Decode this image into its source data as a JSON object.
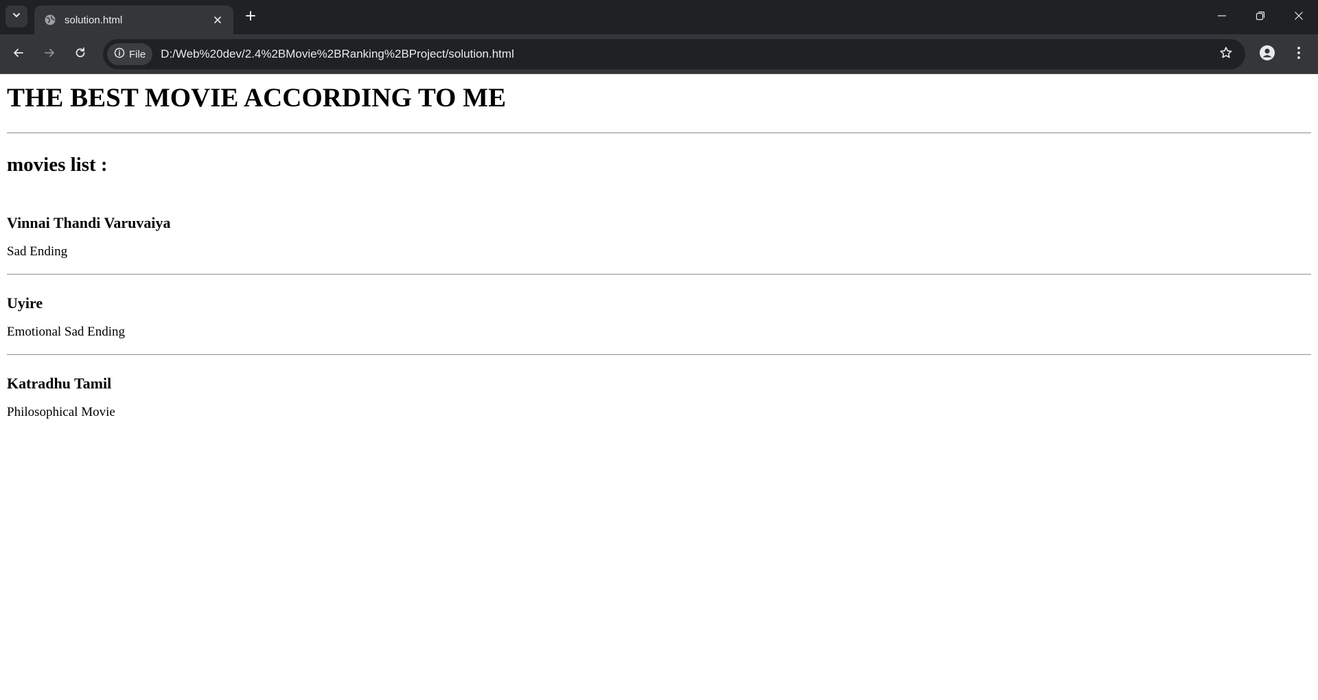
{
  "browser": {
    "tab": {
      "title": "solution.html"
    },
    "address_bar": {
      "site_chip_label": "File",
      "url": "D:/Web%20dev/2.4%2BMovie%2BRanking%2BProject/solution.html"
    },
    "icons": {
      "tab_list": "chevron-down-icon",
      "favicon": "globe-icon",
      "close_tab": "close-icon",
      "new_tab": "plus-icon",
      "minimize": "minimize-icon",
      "restore": "restore-icon",
      "close_window": "close-icon",
      "back": "arrow-left-icon",
      "forward": "arrow-right-icon",
      "reload": "reload-icon",
      "site_info": "info-icon",
      "bookmark": "star-icon",
      "profile": "person-icon",
      "menu": "kebab-menu-icon"
    },
    "colors": {
      "tabstrip_bg": "#202124",
      "toolbar_bg": "#35363a",
      "omnibox_bg": "#202124",
      "text": "#e8eaed"
    }
  },
  "page": {
    "heading": "THE BEST MOVIE ACCORDING TO ME",
    "subheading": "movies list :",
    "movies": [
      {
        "title": "Vinnai Thandi Varuvaiya",
        "description": "Sad Ending"
      },
      {
        "title": "Uyire",
        "description": "Emotional Sad Ending"
      },
      {
        "title": "Katradhu Tamil",
        "description": "Philosophical Movie"
      }
    ]
  }
}
